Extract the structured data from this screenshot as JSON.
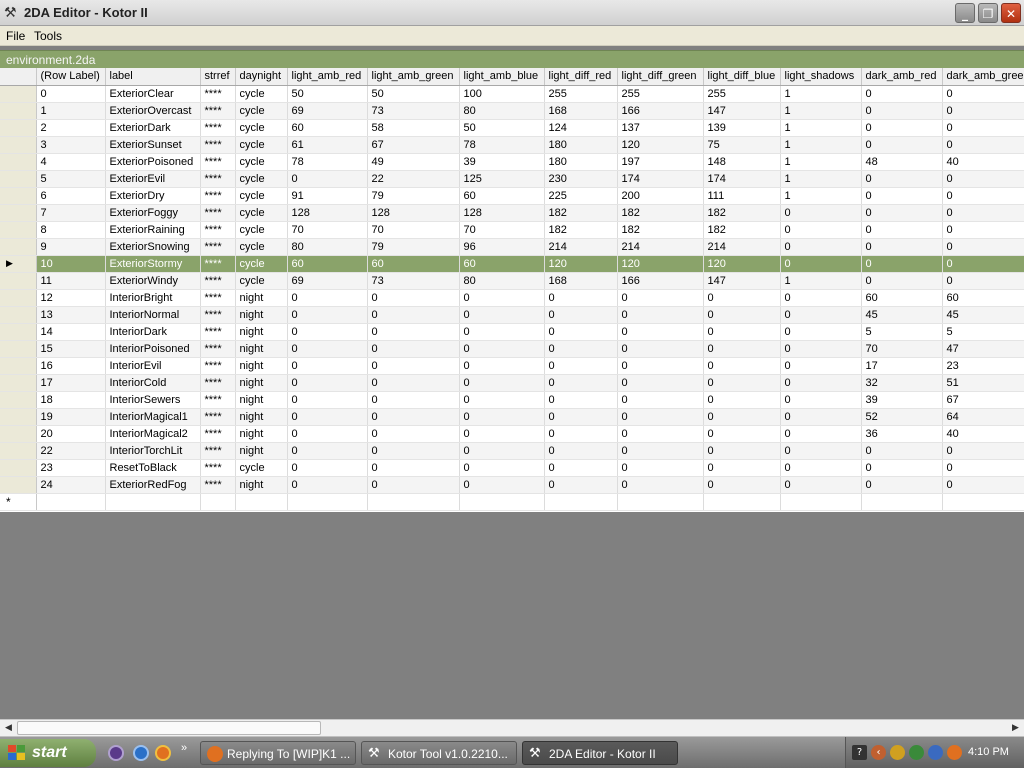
{
  "window": {
    "title": "2DA Editor - Kotor II",
    "min_glyph": "_",
    "max_glyph": "❐",
    "close_glyph": "✕"
  },
  "menu": {
    "file": "File",
    "tools": "Tools"
  },
  "document": {
    "title": "environment.2da"
  },
  "grid": {
    "columns": [
      "(Row Label)",
      "label",
      "strref",
      "daynight",
      "light_amb_red",
      "light_amb_green",
      "light_amb_blue",
      "light_diff_red",
      "light_diff_green",
      "light_diff_blue",
      "light_shadows",
      "dark_amb_red",
      "dark_amb_green"
    ],
    "selected_marker": "▶",
    "new_row_marker": "*",
    "rows": [
      [
        "0",
        "ExteriorClear",
        "****",
        "cycle",
        "50",
        "50",
        "100",
        "255",
        "255",
        "255",
        "1",
        "0",
        "0"
      ],
      [
        "1",
        "ExteriorOvercast",
        "****",
        "cycle",
        "69",
        "73",
        "80",
        "168",
        "166",
        "147",
        "1",
        "0",
        "0"
      ],
      [
        "2",
        "ExteriorDark",
        "****",
        "cycle",
        "60",
        "58",
        "50",
        "124",
        "137",
        "139",
        "1",
        "0",
        "0"
      ],
      [
        "3",
        "ExteriorSunset",
        "****",
        "cycle",
        "61",
        "67",
        "78",
        "180",
        "120",
        "75",
        "1",
        "0",
        "0"
      ],
      [
        "4",
        "ExteriorPoisoned",
        "****",
        "cycle",
        "78",
        "49",
        "39",
        "180",
        "197",
        "148",
        "1",
        "48",
        "40"
      ],
      [
        "5",
        "ExteriorEvil",
        "****",
        "cycle",
        "0",
        "22",
        "125",
        "230",
        "174",
        "174",
        "1",
        "0",
        "0"
      ],
      [
        "6",
        "ExteriorDry",
        "****",
        "cycle",
        "91",
        "79",
        "60",
        "225",
        "200",
        "111",
        "1",
        "0",
        "0"
      ],
      [
        "7",
        "ExteriorFoggy",
        "****",
        "cycle",
        "128",
        "128",
        "128",
        "182",
        "182",
        "182",
        "0",
        "0",
        "0"
      ],
      [
        "8",
        "ExteriorRaining",
        "****",
        "cycle",
        "70",
        "70",
        "70",
        "182",
        "182",
        "182",
        "0",
        "0",
        "0"
      ],
      [
        "9",
        "ExteriorSnowing",
        "****",
        "cycle",
        "80",
        "79",
        "96",
        "214",
        "214",
        "214",
        "0",
        "0",
        "0"
      ],
      [
        "10",
        "ExteriorStormy",
        "****",
        "cycle",
        "60",
        "60",
        "60",
        "120",
        "120",
        "120",
        "0",
        "0",
        "0"
      ],
      [
        "11",
        "ExteriorWindy",
        "****",
        "cycle",
        "69",
        "73",
        "80",
        "168",
        "166",
        "147",
        "1",
        "0",
        "0"
      ],
      [
        "12",
        "InteriorBright",
        "****",
        "night",
        "0",
        "0",
        "0",
        "0",
        "0",
        "0",
        "0",
        "60",
        "60"
      ],
      [
        "13",
        "InteriorNormal",
        "****",
        "night",
        "0",
        "0",
        "0",
        "0",
        "0",
        "0",
        "0",
        "45",
        "45"
      ],
      [
        "14",
        "InteriorDark",
        "****",
        "night",
        "0",
        "0",
        "0",
        "0",
        "0",
        "0",
        "0",
        "5",
        "5"
      ],
      [
        "15",
        "InteriorPoisoned",
        "****",
        "night",
        "0",
        "0",
        "0",
        "0",
        "0",
        "0",
        "0",
        "70",
        "47"
      ],
      [
        "16",
        "InteriorEvil",
        "****",
        "night",
        "0",
        "0",
        "0",
        "0",
        "0",
        "0",
        "0",
        "17",
        "23"
      ],
      [
        "17",
        "InteriorCold",
        "****",
        "night",
        "0",
        "0",
        "0",
        "0",
        "0",
        "0",
        "0",
        "32",
        "51"
      ],
      [
        "18",
        "InteriorSewers",
        "****",
        "night",
        "0",
        "0",
        "0",
        "0",
        "0",
        "0",
        "0",
        "39",
        "67"
      ],
      [
        "19",
        "InteriorMagical1",
        "****",
        "night",
        "0",
        "0",
        "0",
        "0",
        "0",
        "0",
        "0",
        "52",
        "64"
      ],
      [
        "20",
        "InteriorMagical2",
        "****",
        "night",
        "0",
        "0",
        "0",
        "0",
        "0",
        "0",
        "0",
        "36",
        "40"
      ],
      [
        "22",
        "InteriorTorchLit",
        "****",
        "night",
        "0",
        "0",
        "0",
        "0",
        "0",
        "0",
        "0",
        "0",
        "0"
      ],
      [
        "23",
        "ResetToBlack",
        "****",
        "cycle",
        "0",
        "0",
        "0",
        "0",
        "0",
        "0",
        "0",
        "0",
        "0"
      ],
      [
        "24",
        "ExteriorRedFog",
        "****",
        "night",
        "0",
        "0",
        "0",
        "0",
        "0",
        "0",
        "0",
        "0",
        "0"
      ]
    ],
    "selected_row_index": 10
  },
  "scrollbar": {
    "left_arrow": "◀",
    "right_arrow": "▶"
  },
  "taskbar": {
    "start_label": "start",
    "quicklaunch_more": "»",
    "tasks": [
      {
        "label": "Replying To [WIP]K1 ...",
        "icon": "firefox-icon"
      },
      {
        "label": "Kotor Tool v1.0.2210...",
        "icon": "kotor-tool-icon"
      },
      {
        "label": "2DA Editor - Kotor II",
        "icon": "kotor-tool-icon"
      }
    ],
    "clock": "4:10 PM"
  },
  "colors": {
    "selection": "#8aa36a",
    "titlebar": "#d8d8d8",
    "taskbar": "#7e7e7e"
  }
}
